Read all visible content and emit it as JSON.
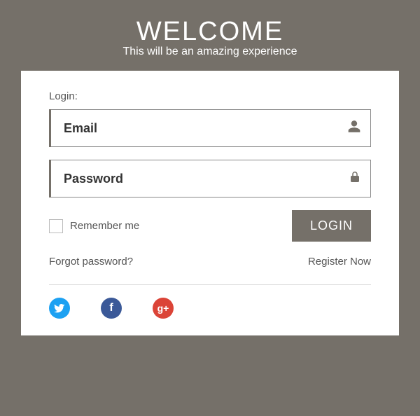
{
  "header": {
    "title": "WELCOME",
    "subtitle": "This will be an amazing experience"
  },
  "form": {
    "label": "Login:",
    "email_placeholder": "Email",
    "password_placeholder": "Password",
    "remember_label": "Remember me",
    "login_button": "LOGIN"
  },
  "links": {
    "forgot": "Forgot password?",
    "register": "Register Now"
  },
  "social": {
    "twitter": "twitter",
    "facebook": "facebook",
    "gplus": "google-plus"
  }
}
